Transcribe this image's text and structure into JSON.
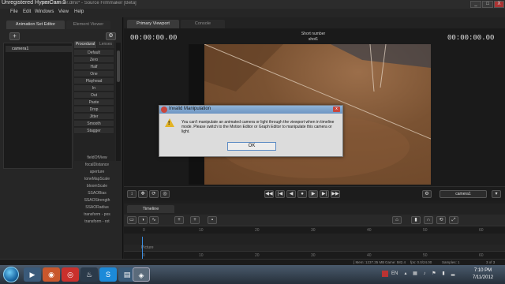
{
  "hypercam_label": "Unregistered HyperCam 3",
  "window": {
    "title": "Shot number.dmx* - Source Filmmaker [Beta]",
    "minimize": "_",
    "maximize": "□",
    "close": "X"
  },
  "menu": [
    "File",
    "Edit",
    "Windows",
    "View",
    "Help"
  ],
  "left_panel": {
    "tabs": [
      "Animation Set Editor",
      "Element Viewer"
    ],
    "add_button": "+",
    "gear": "⚙",
    "tree_item": "camera1",
    "proc_tabs": [
      "Procedural",
      "Lenses"
    ],
    "procedural_buttons": [
      "Default",
      "Zero",
      "Half",
      "One",
      "Playhead",
      "In",
      "Out",
      "Paste",
      "Drop",
      "Jitter",
      "Smooth",
      "Stagger"
    ],
    "controls": [
      "fieldOfView",
      "focalDistance",
      "aperture",
      "toneMapScale",
      "bloomScale",
      "SSAOBias",
      "SSAOStrength",
      "SSAORadius",
      "transform - pos",
      "transform - rot"
    ]
  },
  "viewport": {
    "tabs": [
      "Primary Viewport",
      "Console"
    ],
    "timecode_left": "00:00:00.00",
    "timecode_right": "00:00:00.00",
    "shot_title": "Short number",
    "shot_name": "shot1",
    "camera_select": "camera1",
    "controls": [
      "◀◀",
      "|◀",
      "◀",
      "●",
      "▶",
      "▶|",
      "▶▶"
    ]
  },
  "dialog": {
    "title": "Invalid Manipulation",
    "close": "x",
    "icon": "warning-icon",
    "message": "You can't manipulate an animated camera or light through the viewport when in timeline mode. Please switch to the Motion Editor or Graph Editor to manipulate this camera or light.",
    "ok_label": "OK"
  },
  "timeline": {
    "tab": "Timeline",
    "ruler_top": [
      "0",
      "10",
      "20",
      "30",
      "40",
      "50",
      "60"
    ],
    "ruler_bottom": [
      "0",
      "10",
      "20",
      "30",
      "40",
      "50",
      "60"
    ],
    "track_label": "Picture"
  },
  "status": {
    "mem": "[ Mem: 1237.35 MB",
    "game": "Game: 582.4",
    "fps": "fps: 0.0/24.00",
    "samples": "Samples: 1",
    "count": "3 of 3"
  },
  "taskbar": {
    "time": "7:10 PM",
    "date": "7/11/2012",
    "tray_lang": "EN"
  },
  "colors": {
    "accent": "#3b8de0",
    "warning": "#e3b324",
    "dialog_title": "#6d95c3"
  }
}
